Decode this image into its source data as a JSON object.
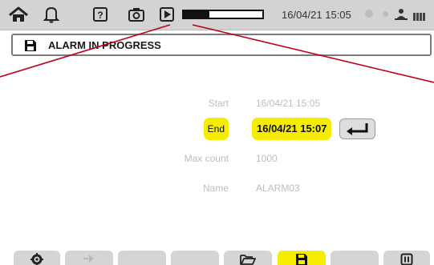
{
  "status_bar": {
    "datetime": "16/04/21 15:05",
    "recording_progress": 0.33
  },
  "title_bar": {
    "title": "ALARM IN PROGRESS"
  },
  "form": {
    "start_label": "Start",
    "start_value": "16/04/21 15:05",
    "end_label": "End",
    "end_value": "16/04/21 15:07",
    "max_count_label": "Max count",
    "max_count_value": "1000",
    "name_label": "Name",
    "name_value": "ALARM03"
  },
  "icons": {
    "home": "home-icon",
    "bell": "bell-icon",
    "help": "help-icon",
    "camera": "camera-icon",
    "play": "play-icon",
    "save": "floppy-disk-icon",
    "enter": "enter-return-icon",
    "settings": "gear-icon",
    "folder": "folder-open-icon",
    "pause": "pause-icon"
  },
  "colors": {
    "highlight": "#f5ec00",
    "annotation_line": "#c0001a",
    "status_bar_bg": "#d3d3d3"
  }
}
